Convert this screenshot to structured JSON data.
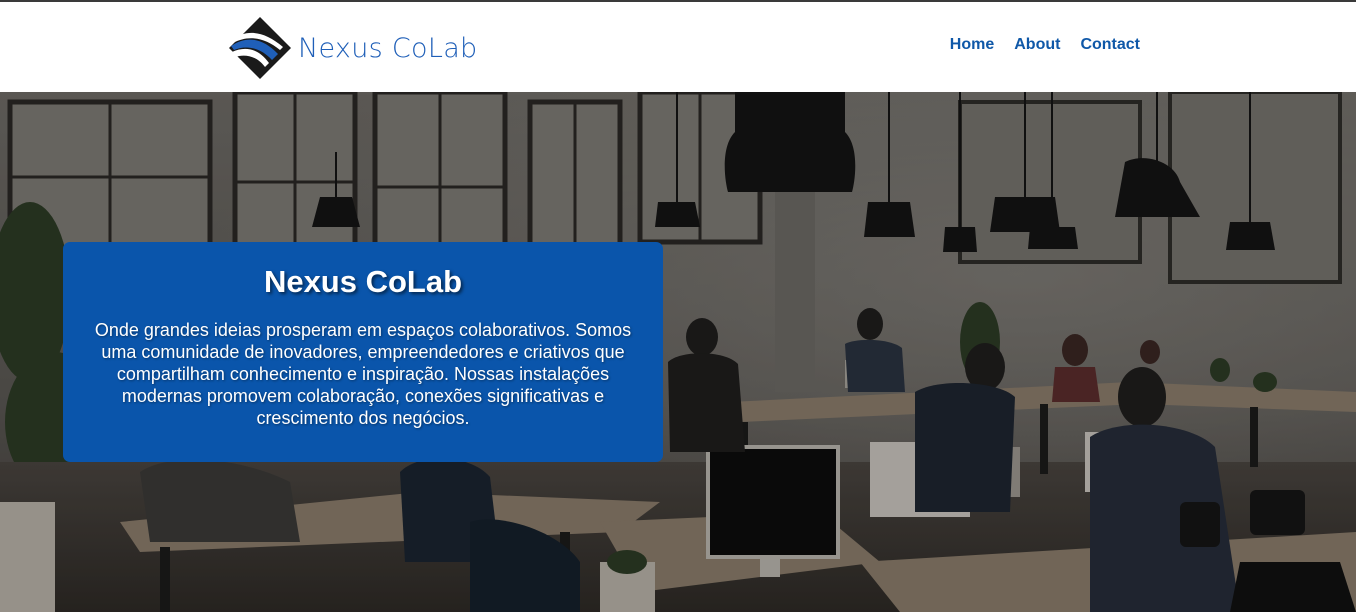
{
  "brand": {
    "name": "Nexus CoLab",
    "logo_icon": "nexus-logo-icon",
    "color": "#1f5fb8"
  },
  "nav": {
    "home": "Home",
    "about": "About",
    "contact": "Contact",
    "color": "#0f58a8"
  },
  "hero": {
    "background_image": "coworking-office-photo",
    "title": "Nexus CoLab",
    "description": "Onde grandes ideias prosperam em espaços colaborativos. Somos uma comunidade de inovadores, empreendedores e criativos que compartilham conhecimento e inspiração. Nossas instalações modernas promovem colaboração, conexões significativas e crescimento dos negócios.",
    "card_color": "#0a55ab"
  }
}
